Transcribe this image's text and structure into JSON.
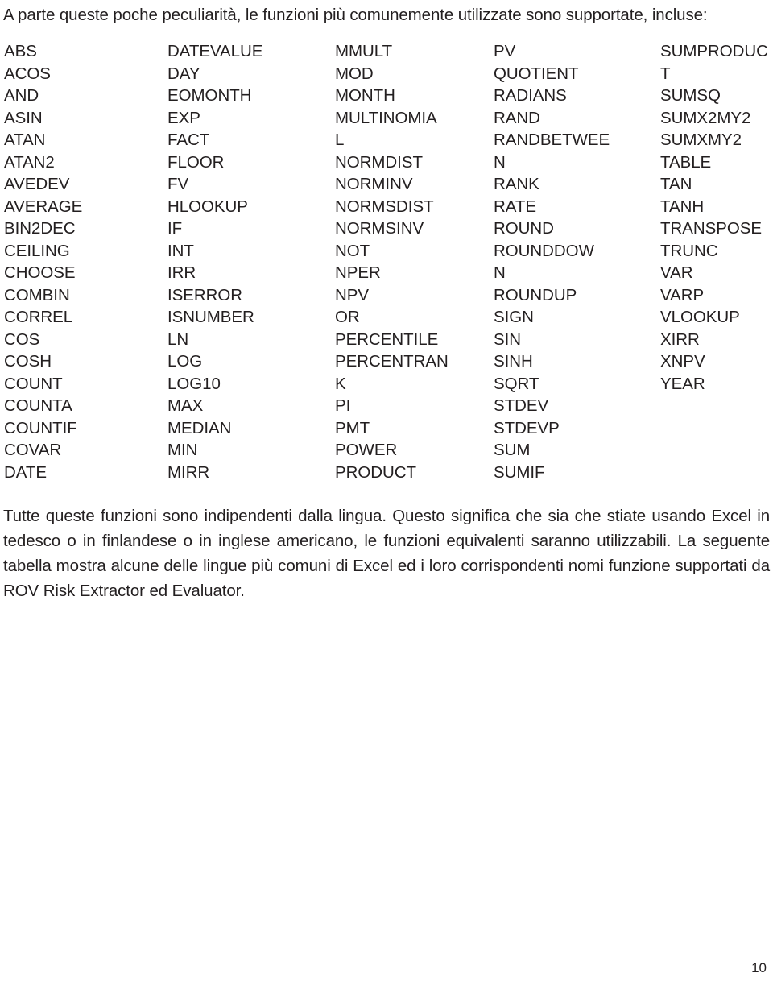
{
  "document": {
    "intro_line": "A parte queste poche peculiarità, le funzioni più comunemente utilizzate sono supportate, incluse:",
    "closing_paragraph": "Tutte queste funzioni sono indipendenti dalla lingua. Questo significa che sia che stiate usando Excel in tedesco o in finlandese o in inglese americano, le funzioni equivalenti saranno utilizzabili. La seguente tabella mostra alcune delle lingue più comuni di Excel ed i loro corrispondenti nomi funzione supportati da ROV Risk Extractor ed Evaluator.",
    "page_number": "10"
  },
  "function_list": {
    "columns": [
      {
        "index": 0,
        "items": [
          "ABS",
          "ACOS",
          "AND",
          "ASIN",
          "ATAN",
          "ATAN2",
          "AVEDEV",
          "AVERAGE",
          "BIN2DEC",
          "CEILING",
          "CHOOSE",
          "COMBIN",
          "CORREL",
          "COS",
          "COSH",
          "COUNT",
          "COUNTA",
          "COUNTIF",
          "COVAR",
          "DATE"
        ]
      },
      {
        "index": 1,
        "items": [
          "DATEVALUE",
          "DAY",
          "EOMONTH",
          "EXP",
          "FACT",
          "FLOOR",
          "FV",
          "HLOOKUP",
          "IF",
          "INT",
          "IRR",
          "ISERROR",
          "ISNUMBER",
          "LN",
          "LOG",
          "LOG10",
          "MAX",
          "MEDIAN",
          "MIN",
          "MIRR"
        ]
      },
      {
        "index": 2,
        "items": [
          "MMULT",
          "MOD",
          "MONTH",
          "MULTINOMIA",
          "L",
          "NORMDIST",
          "NORMINV",
          "NORMSDIST",
          "NORMSINV",
          "NOT",
          "NPER",
          "NPV",
          "OR",
          "PERCENTILE",
          "PERCENTRAN",
          "K",
          "PI",
          "PMT",
          "POWER",
          "PRODUCT"
        ]
      },
      {
        "index": 3,
        "items": [
          "PV",
          "QUOTIENT",
          "RADIANS",
          "RAND",
          "RANDBETWEE",
          "N",
          "RANK",
          "RATE",
          "ROUND",
          "ROUNDDOW",
          "N",
          "ROUNDUP",
          "SIGN",
          "SIN",
          "SINH",
          "SQRT",
          "STDEV",
          "STDEVP",
          "SUM",
          "SUMIF"
        ]
      },
      {
        "index": 4,
        "items": [
          "SUMPRODUC",
          "T",
          "SUMSQ",
          "SUMX2MY2",
          "SUMXMY2",
          "TABLE",
          "TAN",
          "TANH",
          "TRANSPOSE",
          "TRUNC",
          "VAR",
          "VARP",
          "VLOOKUP",
          "XIRR",
          "XNPV",
          "YEAR"
        ]
      }
    ]
  }
}
